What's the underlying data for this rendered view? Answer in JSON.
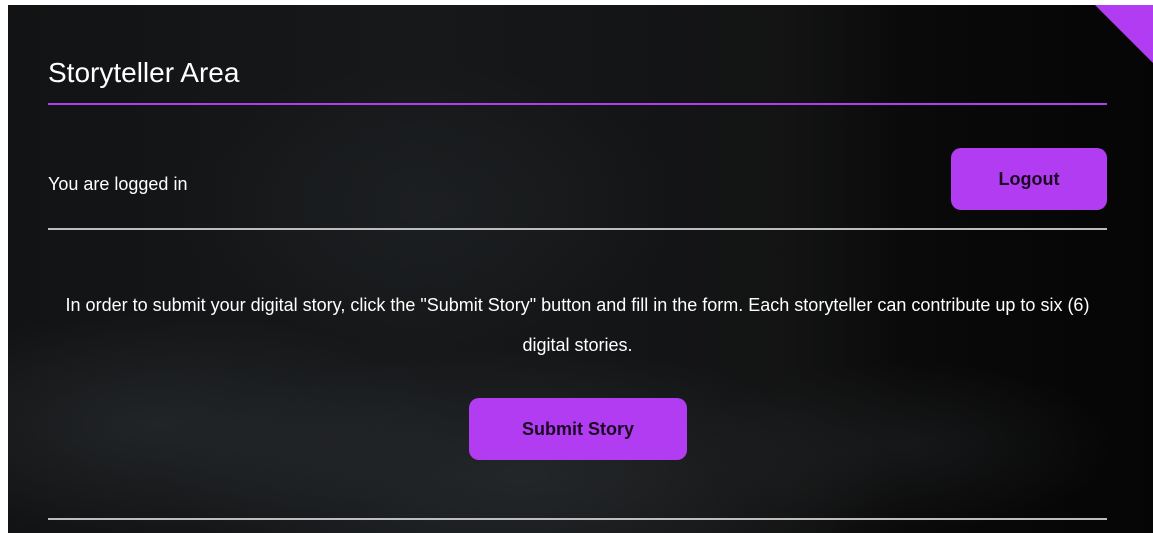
{
  "page": {
    "title": "Storyteller Area",
    "accent_color": "#b23cf2"
  },
  "session": {
    "status_text": "You are logged in",
    "logout_label": "Logout"
  },
  "instructions": {
    "text": "In order to submit your digital story, click the \"Submit Story\" button and fill in the form. Each storyteller can contribute up to six (6) digital stories."
  },
  "actions": {
    "submit_label": "Submit Story"
  }
}
